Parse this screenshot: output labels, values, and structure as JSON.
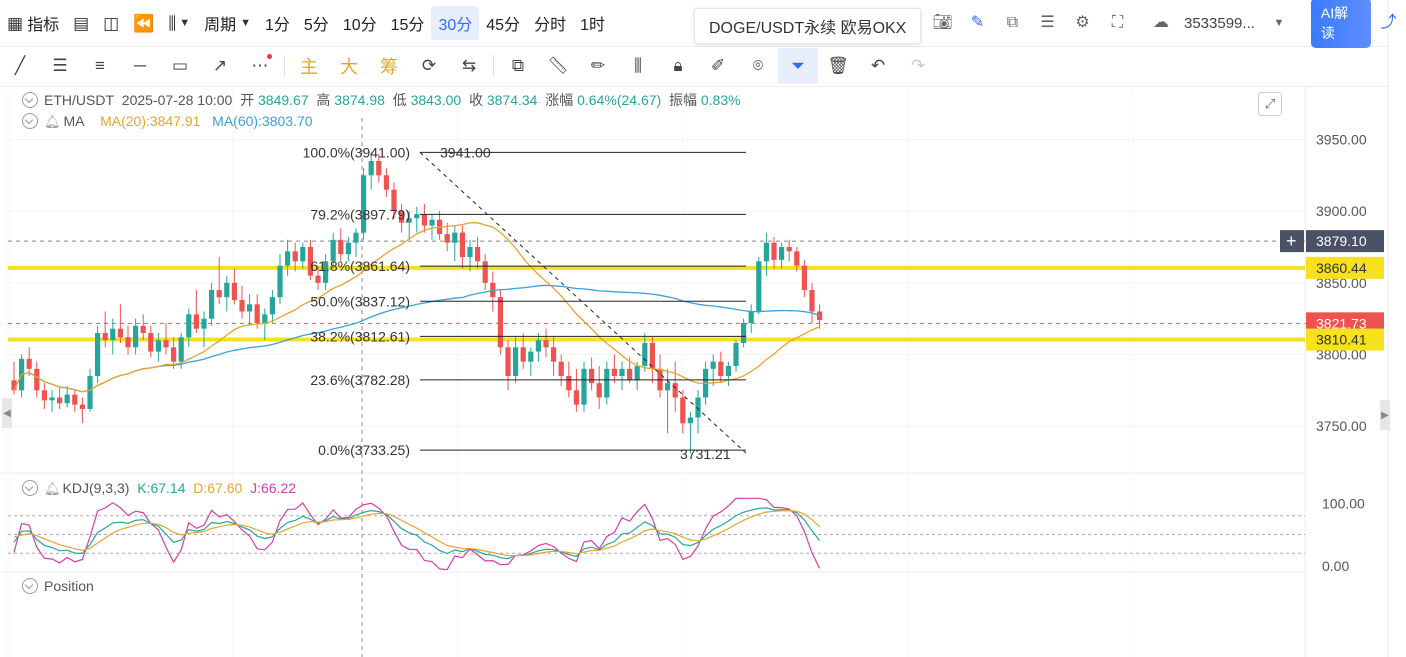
{
  "toolbar": {
    "indicators": "指标",
    "period": "周期",
    "intervals": [
      "1分",
      "5分",
      "10分",
      "15分",
      "30分",
      "45分",
      "分时",
      "1时"
    ],
    "active_interval": "30分",
    "symbol_tooltip": "DOGE/USDT永续 欧易OKX",
    "account": "3533599...",
    "ai_button": "AI解读"
  },
  "drawing_tools": {
    "main": "主",
    "big": "大",
    "chips": "筹"
  },
  "legend": {
    "symbol": "ETH/USDT",
    "datetime": "2025-07-28 10:00",
    "open_label": "开",
    "open": "3849.67",
    "high_label": "高",
    "high": "3874.98",
    "low_label": "低",
    "low": "3843.00",
    "close_label": "收",
    "close": "3874.34",
    "change_label": "涨幅",
    "change": "0.64%(24.67)",
    "amp_label": "振幅",
    "amp": "0.83%",
    "ma_name": "MA",
    "ma20": "MA(20):3847.91",
    "ma60": "MA(60):3803.70",
    "kdj_name": "KDJ(9,3,3)",
    "k": "K:67.14",
    "d": "D:67.60",
    "j": "J:66.22",
    "position": "Position"
  },
  "colors": {
    "up": "#26a69a",
    "down": "#ef5350",
    "ma20": "#e8a42b",
    "ma60": "#3ba2d6",
    "k": "#26a69a",
    "d": "#e8a42b",
    "j": "#d43fa8",
    "hline": "#f7e01c",
    "accent": "#2f6bff"
  },
  "chart_data": {
    "type": "candlestick",
    "symbol": "ETH/USDT",
    "interval": "30分",
    "ylim": [
      3718,
      3965
    ],
    "yticks": [
      "3950.00",
      "3900.00",
      "3850.00",
      "3800.00",
      "3750.00"
    ],
    "price_labels": [
      {
        "value": 3879.1,
        "text": "3879.10",
        "color": "#4a5066",
        "style": "dashed-gray"
      },
      {
        "value": 3860.44,
        "text": "3860.44",
        "color": "#f7e01c",
        "style": "horizontal-line"
      },
      {
        "value": 3821.73,
        "text": "3821.73",
        "color": "#ef5350",
        "style": "dashed-red"
      },
      {
        "value": 3810.41,
        "text": "3810.41",
        "color": "#f7e01c",
        "style": "horizontal-line"
      }
    ],
    "fibonacci": [
      {
        "level": "100.0%",
        "price": 3941.0,
        "label": "100.0%(3941.00)"
      },
      {
        "level": "79.2%",
        "price": 3897.79,
        "label": "79.2%(3897.79)"
      },
      {
        "level": "61.8%",
        "price": 3861.64,
        "label": "61.8%(3861.64)"
      },
      {
        "level": "50.0%",
        "price": 3837.12,
        "label": "50.0%(3837.12)"
      },
      {
        "level": "38.2%",
        "price": 3812.61,
        "label": "38.2%(3812.61)"
      },
      {
        "level": "23.6%",
        "price": 3782.28,
        "label": "23.6%(3782.28)"
      },
      {
        "level": "0.0%",
        "price": 3733.25,
        "label": "0.0%(3733.25)"
      }
    ],
    "fib_start_label": "3941.00",
    "fib_end_label": "3731.21",
    "candles": [
      [
        3782,
        3795,
        3772,
        3775
      ],
      [
        3775,
        3800,
        3770,
        3797
      ],
      [
        3797,
        3805,
        3785,
        3790
      ],
      [
        3790,
        3795,
        3770,
        3775
      ],
      [
        3775,
        3780,
        3762,
        3768
      ],
      [
        3768,
        3775,
        3760,
        3770
      ],
      [
        3770,
        3777,
        3762,
        3766
      ],
      [
        3766,
        3778,
        3763,
        3772
      ],
      [
        3772,
        3775,
        3760,
        3765
      ],
      [
        3765,
        3770,
        3752,
        3762
      ],
      [
        3762,
        3790,
        3760,
        3785
      ],
      [
        3785,
        3820,
        3780,
        3815
      ],
      [
        3815,
        3830,
        3805,
        3810
      ],
      [
        3810,
        3825,
        3800,
        3818
      ],
      [
        3818,
        3835,
        3808,
        3812
      ],
      [
        3812,
        3820,
        3800,
        3805
      ],
      [
        3805,
        3825,
        3800,
        3820
      ],
      [
        3820,
        3828,
        3810,
        3815
      ],
      [
        3815,
        3820,
        3798,
        3802
      ],
      [
        3802,
        3815,
        3795,
        3810
      ],
      [
        3810,
        3822,
        3800,
        3805
      ],
      [
        3805,
        3812,
        3790,
        3795
      ],
      [
        3795,
        3815,
        3790,
        3812
      ],
      [
        3812,
        3832,
        3805,
        3828
      ],
      [
        3828,
        3845,
        3815,
        3818
      ],
      [
        3818,
        3830,
        3805,
        3825
      ],
      [
        3825,
        3850,
        3820,
        3845
      ],
      [
        3845,
        3868,
        3835,
        3840
      ],
      [
        3840,
        3855,
        3830,
        3850
      ],
      [
        3850,
        3860,
        3835,
        3838
      ],
      [
        3838,
        3848,
        3825,
        3830
      ],
      [
        3830,
        3842,
        3820,
        3835
      ],
      [
        3835,
        3842,
        3818,
        3822
      ],
      [
        3822,
        3832,
        3810,
        3828
      ],
      [
        3828,
        3845,
        3822,
        3840
      ],
      [
        3840,
        3870,
        3835,
        3862
      ],
      [
        3862,
        3880,
        3855,
        3872
      ],
      [
        3872,
        3878,
        3858,
        3865
      ],
      [
        3865,
        3878,
        3860,
        3875
      ],
      [
        3875,
        3880,
        3852,
        3855
      ],
      [
        3855,
        3862,
        3845,
        3850
      ],
      [
        3850,
        3870,
        3845,
        3865
      ],
      [
        3865,
        3885,
        3860,
        3880
      ],
      [
        3880,
        3888,
        3865,
        3870
      ],
      [
        3870,
        3882,
        3865,
        3878
      ],
      [
        3878,
        3888,
        3868,
        3885
      ],
      [
        3885,
        3930,
        3880,
        3925
      ],
      [
        3925,
        3941,
        3915,
        3935
      ],
      [
        3935,
        3940,
        3920,
        3925
      ],
      [
        3925,
        3930,
        3910,
        3915
      ],
      [
        3915,
        3920,
        3895,
        3900
      ],
      [
        3900,
        3905,
        3885,
        3892
      ],
      [
        3892,
        3900,
        3880,
        3895
      ],
      [
        3895,
        3903,
        3885,
        3898
      ],
      [
        3898,
        3905,
        3885,
        3890
      ],
      [
        3890,
        3898,
        3880,
        3894
      ],
      [
        3894,
        3900,
        3880,
        3884
      ],
      [
        3884,
        3892,
        3872,
        3878
      ],
      [
        3878,
        3890,
        3865,
        3885
      ],
      [
        3885,
        3890,
        3860,
        3868
      ],
      [
        3868,
        3880,
        3858,
        3875
      ],
      [
        3875,
        3882,
        3860,
        3865
      ],
      [
        3865,
        3870,
        3845,
        3850
      ],
      [
        3850,
        3858,
        3830,
        3840
      ],
      [
        3840,
        3845,
        3800,
        3805
      ],
      [
        3805,
        3810,
        3775,
        3785
      ],
      [
        3785,
        3812,
        3780,
        3805
      ],
      [
        3805,
        3815,
        3790,
        3795
      ],
      [
        3795,
        3805,
        3785,
        3802
      ],
      [
        3802,
        3815,
        3795,
        3810
      ],
      [
        3810,
        3818,
        3798,
        3805
      ],
      [
        3805,
        3812,
        3785,
        3795
      ],
      [
        3795,
        3800,
        3778,
        3785
      ],
      [
        3785,
        3795,
        3770,
        3775
      ],
      [
        3775,
        3790,
        3760,
        3765
      ],
      [
        3765,
        3795,
        3760,
        3790
      ],
      [
        3790,
        3798,
        3775,
        3780
      ],
      [
        3780,
        3792,
        3762,
        3770
      ],
      [
        3770,
        3795,
        3765,
        3790
      ],
      [
        3790,
        3800,
        3780,
        3785
      ],
      [
        3785,
        3795,
        3775,
        3790
      ],
      [
        3790,
        3798,
        3780,
        3782
      ],
      [
        3782,
        3795,
        3775,
        3792
      ],
      [
        3792,
        3815,
        3788,
        3808
      ],
      [
        3808,
        3812,
        3780,
        3790
      ],
      [
        3790,
        3800,
        3770,
        3775
      ],
      [
        3775,
        3790,
        3745,
        3780
      ],
      [
        3780,
        3795,
        3760,
        3770
      ],
      [
        3770,
        3775,
        3745,
        3752
      ],
      [
        3752,
        3760,
        3731,
        3756
      ],
      [
        3756,
        3775,
        3745,
        3770
      ],
      [
        3770,
        3795,
        3765,
        3790
      ],
      [
        3790,
        3800,
        3778,
        3795
      ],
      [
        3795,
        3802,
        3780,
        3785
      ],
      [
        3785,
        3795,
        3778,
        3792
      ],
      [
        3792,
        3810,
        3788,
        3808
      ],
      [
        3808,
        3825,
        3805,
        3822
      ],
      [
        3822,
        3835,
        3815,
        3830
      ],
      [
        3830,
        3868,
        3828,
        3865
      ],
      [
        3865,
        3885,
        3855,
        3878
      ],
      [
        3878,
        3882,
        3860,
        3866
      ],
      [
        3866,
        3878,
        3860,
        3875
      ],
      [
        3875,
        3880,
        3865,
        3872
      ],
      [
        3872,
        3875,
        3858,
        3862
      ],
      [
        3862,
        3866,
        3840,
        3845
      ],
      [
        3845,
        3850,
        3822,
        3830
      ],
      [
        3830,
        3835,
        3818,
        3824
      ]
    ],
    "kdj": {
      "ylim": [
        -10,
        110
      ],
      "yticks": [
        "100.00",
        "0.00"
      ],
      "K": 67.14,
      "D": 67.6,
      "J": 66.22
    }
  }
}
